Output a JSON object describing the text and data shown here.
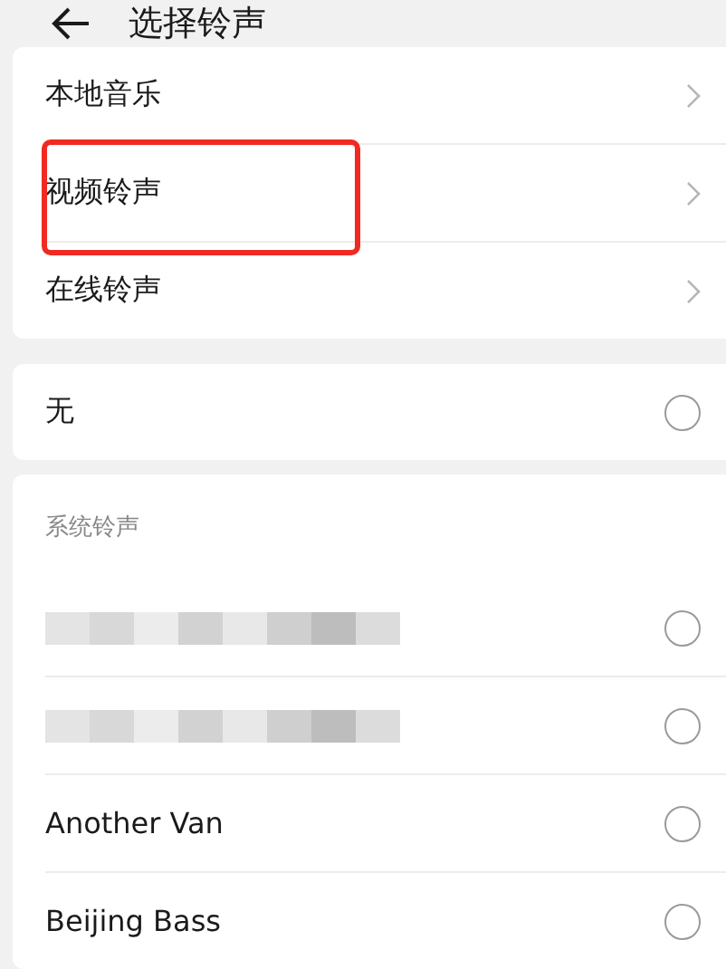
{
  "header": {
    "title": "选择铃声"
  },
  "sources": [
    {
      "label": "本地音乐",
      "highlighted": false
    },
    {
      "label": "视频铃声",
      "highlighted": true
    },
    {
      "label": "在线铃声",
      "highlighted": false
    }
  ],
  "none_option": {
    "label": "无",
    "selected": false
  },
  "system_ringtones": {
    "heading": "系统铃声",
    "items": [
      {
        "kind": "redacted",
        "selected": false
      },
      {
        "kind": "redacted",
        "selected": false
      },
      {
        "kind": "text",
        "label": "Another Van",
        "selected": false
      },
      {
        "kind": "text",
        "label": "Beijing Bass",
        "selected": false
      }
    ]
  }
}
